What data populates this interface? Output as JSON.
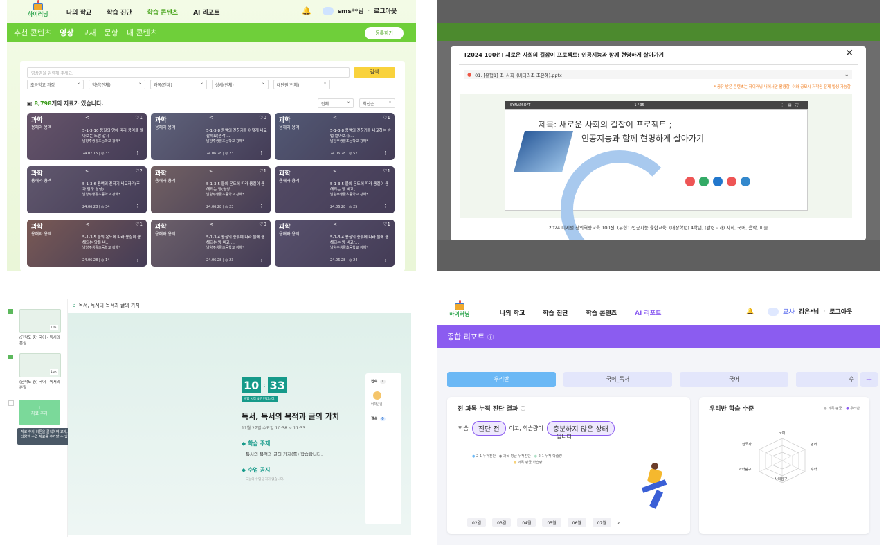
{
  "q1": {
    "nav": [
      "나의 학교",
      "학습 진단",
      "학습 콘텐츠",
      "AI 리포트"
    ],
    "nav_active": 2,
    "user": "sms**님",
    "logout": "로그아웃",
    "logo": "하이러닝",
    "tabs": [
      "추천 콘텐츠",
      "영상",
      "교재",
      "문항",
      "내 콘텐츠"
    ],
    "register": "등록하기",
    "search_placeholder": "영상명을 입력해 주세요.",
    "search_btn": "검색",
    "filters": [
      "초등학교 과정",
      "학년(전체)",
      "과목(전체)",
      "상세(전체)",
      "대단원(전체)"
    ],
    "count_num": "8,798",
    "count_suffix": "개의 자료가 있습니다.",
    "sort1": "전체",
    "sort2": "최신순",
    "cards": [
      {
        "subj": "과학",
        "sub": "용해와 용액",
        "title": "5-1-3-10 용질의 양에 따라 용액을 알아보는 도람 갑사",
        "school": "남양주생활초등학교 강해*",
        "meta": "24.07.15 | ◎ 33",
        "like": "1"
      },
      {
        "subj": "과학",
        "sub": "용해와 용액",
        "title": "5-1-3-8 용액의 진하기를 어떻게 비교할까요(생각 ...",
        "school": "남양주생활초등학교 강해*",
        "meta": "24.06.28 | ◎ 23",
        "like": "0"
      },
      {
        "subj": "과학",
        "sub": "용해와 용액",
        "title": "5-1-3-8 용액의 진하기를 비교하는 방법 알아보기(...",
        "school": "남양주생활초등학교 강해*",
        "meta": "24.06.28 | ◎ 57",
        "like": "1"
      },
      {
        "subj": "과학",
        "sub": "용해와 용액",
        "title": "5-1-3-6 용액의 진하기 비교하기(추가 탐구 영상)",
        "school": "남양주생활초등학교 강해*",
        "meta": "24.06.28 | ◎ 34",
        "like": "2"
      },
      {
        "subj": "과학",
        "sub": "용해와 용액",
        "title": "5-1-3-5 물의 온도에 따라 용질이 용해되는 양(영상 ...",
        "school": "남양주생활초등학교 강해*",
        "meta": "24.06.28 | ◎ 23",
        "like": "1"
      },
      {
        "subj": "과학",
        "sub": "용해와 용액",
        "title": "5-1-3-5 물의 온도에 따라 용질이 용해되는 양 비교(...",
        "school": "남양주생활초등학교 강해*",
        "meta": "24.06.28 | ◎ 25",
        "like": "1"
      },
      {
        "subj": "과학",
        "sub": "용해와 용액",
        "title": "5-1-3-5 물의 온도에 따라 용질이 용해되는 양을 비...",
        "school": "남양주생활초등학교 강해*",
        "meta": "24.06.28 | ◎ 14",
        "like": "1"
      },
      {
        "subj": "과학",
        "sub": "용해와 용액",
        "title": "5-1-3-4 용질의 종류에 따라 물에 용해되는 양 비교 ...",
        "school": "남양주생활초등학교 강해*",
        "meta": "24.06.28 | ◎ 23",
        "like": "0"
      },
      {
        "subj": "과학",
        "sub": "용해와 용액",
        "title": "5-1-3-4 용질의 종류에 따라 물에 용해되는 양 비교(...",
        "school": "남양주생활초등학교 강해*",
        "meta": "24.06.28 | ◎ 24",
        "like": "1"
      }
    ]
  },
  "q2": {
    "title": "[2024 100선] 새로운 사회의 길잡이 프로젝트: 인공지능과 함께 현명하게 살아가기",
    "file": "01. [유형1] 초_사회_(베다리초 조은혜).pptx",
    "notice": "* 공유 받은 콘텐츠는 하이러닝 내에서만 활용함. 이와 공모시 저작권 문제 발생 가능함",
    "viewer": "SYNAPSOFT",
    "page": "1 / 35",
    "slide_line1": "제목: 새로운 사회의 길잡이 프로젝트 ;",
    "slide_line2": "인공지능과 함께 현명하게 살아가기",
    "caption": "2024 디지털 창의역량교육 100선, (유형1)인공지능 융합교육, (대상학년) 4학년, (관련교과) 사회, 국어, 음악, 미술"
  },
  "q3": {
    "breadcrumb": "독서, 독서의 목적과 글의 가치",
    "items": [
      {
        "badge": "1교시",
        "label": "(단락도 중) 국어 - 독서의 본질"
      },
      {
        "badge": "1교시",
        "label": "(단락도 중) 국어 - 독서의 본질"
      }
    ],
    "add_label": "자료 추가",
    "tooltip": "자료 추가 버튼을 클릭하여 교재, 문제집 등 다양한 수업 자료를 추가할 수 있습니다.",
    "clock_h": "10",
    "clock_m": "33",
    "clock_note": "수업 시작 4분 전입니다.",
    "lesson_title": "독서, 독서의 목적과 글의 가치",
    "lesson_time": "11월 27일 수요일 10:38 ~ 11:33",
    "topic_h": "학습 주제",
    "topic_body": "독서의 목적과 글의 가치(를) 학습합니다.",
    "notice_h": "수업 공지",
    "notice_body": "오늘의 수업 공지가 없습니다.",
    "right_join": "접속",
    "right_join_n": "1",
    "right_person": "이학년님",
    "right_absent": "결속",
    "right_absent_n": "0"
  },
  "q4": {
    "logo": "하이러닝",
    "nav": [
      "나의 학교",
      "학습 진단",
      "학습 콘텐츠",
      "AI 리포트"
    ],
    "nav_active": 3,
    "role": "교사",
    "user": "김은*님",
    "logout": "로그아웃",
    "banner": "종합 리포트",
    "tabs": [
      "우리반",
      "국어_독서",
      "국어",
      "수"
    ],
    "left_title": "전 과목 누적 진단 결과",
    "sent1": "학습",
    "chip1": "진단 전",
    "sent2": "이고, 학습량이",
    "chip2": "충분하지 않은 상태",
    "sent3": "입니다.",
    "legend": [
      "2-1 누적진단",
      "과목 평균 누적진단",
      "2-1 누적 학습량",
      "과목 평균 학습량"
    ],
    "months": [
      "02월",
      "03월",
      "04월",
      "05월",
      "06월",
      "07월"
    ],
    "right_title": "우리반 학습 수준",
    "right_legend": [
      "과목 평균",
      "우리반"
    ],
    "radar": [
      "국어",
      "영어",
      "수학",
      "사회탐구",
      "과학탐구",
      "한국사"
    ]
  }
}
